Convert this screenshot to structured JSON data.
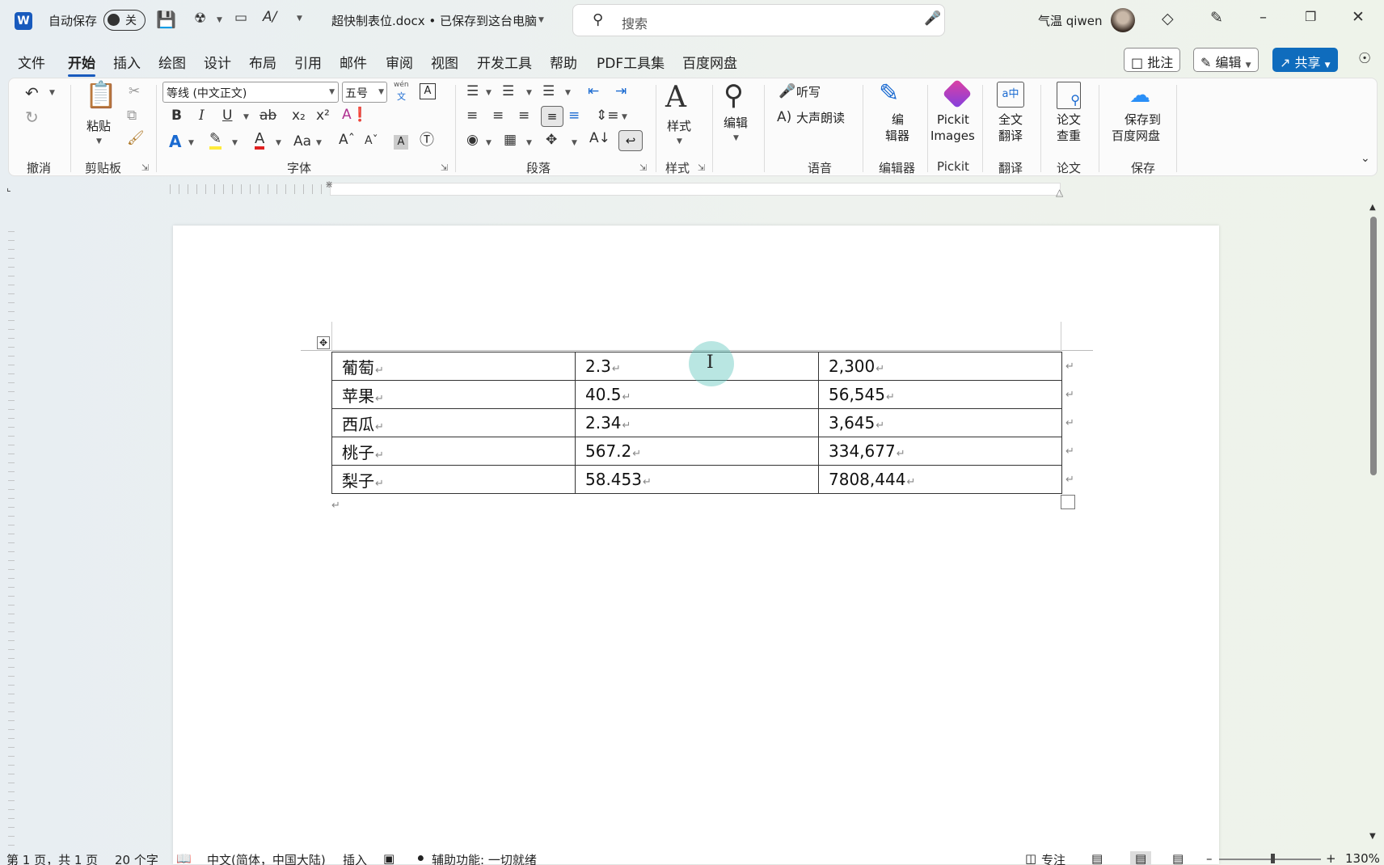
{
  "titlebar": {
    "autosave_label": "自动保存",
    "autosave_state": "关",
    "doc_title": "超快制表位.docx • 已保存到这台电脑",
    "search_placeholder": "搜索",
    "user_name": "气温 qiwen"
  },
  "menu": [
    "文件",
    "开始",
    "插入",
    "绘图",
    "设计",
    "布局",
    "引用",
    "邮件",
    "审阅",
    "视图",
    "开发工具",
    "帮助",
    "PDF工具集",
    "百度网盘"
  ],
  "menu_active": "开始",
  "menu_right": {
    "comments": "批注",
    "edit": "编辑",
    "share": "共享"
  },
  "ribbon": {
    "undo_group": "撤消",
    "paste_label": "粘贴",
    "clipboard_group": "剪贴板",
    "font_name": "等线 (中文正文)",
    "font_size": "五号",
    "phonetic_top": "wén",
    "phonetic_bottom": "文",
    "font_group": "字体",
    "paragraph_group": "段落",
    "styles_label": "样式",
    "styles_group": "样式",
    "editing_label": "编辑",
    "dictate_label": "听写",
    "read_aloud_label": "大声朗读",
    "voice_group": "语音",
    "editor_label_1": "编",
    "editor_label_2": "辑器",
    "editor_group": "编辑器",
    "pickit_label_1": "Pickit",
    "pickit_label_2": "Images",
    "pickit_group": "Pickit",
    "translate_label_1": "全文",
    "translate_label_2": "翻译",
    "translate_group": "翻译",
    "paper_label_1": "论文",
    "paper_label_2": "查重",
    "paper_group": "论文",
    "baidu_label_1": "保存到",
    "baidu_label_2": "百度网盘",
    "baidu_group": "保存"
  },
  "table": {
    "rows": [
      [
        "葡萄",
        "2.3",
        "2,300"
      ],
      [
        "苹果",
        "40.5",
        "56,545"
      ],
      [
        "西瓜",
        "2.34",
        "3,645"
      ],
      [
        "桃子",
        "567.2",
        "334,677"
      ],
      [
        "梨子",
        "58.453",
        "7808,444"
      ]
    ]
  },
  "status": {
    "page": "第 1 页，共 1 页",
    "words": "20 个字",
    "language": "中文(简体，中国大陆)",
    "mode": "插入",
    "accessibility": "辅助功能: 一切就绪",
    "focus": "专注",
    "zoom": "130%"
  },
  "colors": {
    "word_blue": "#185abd",
    "share_button": "#0f6cbd",
    "highlight_yellow": "#ffeb3b",
    "font_red": "#e02020"
  }
}
